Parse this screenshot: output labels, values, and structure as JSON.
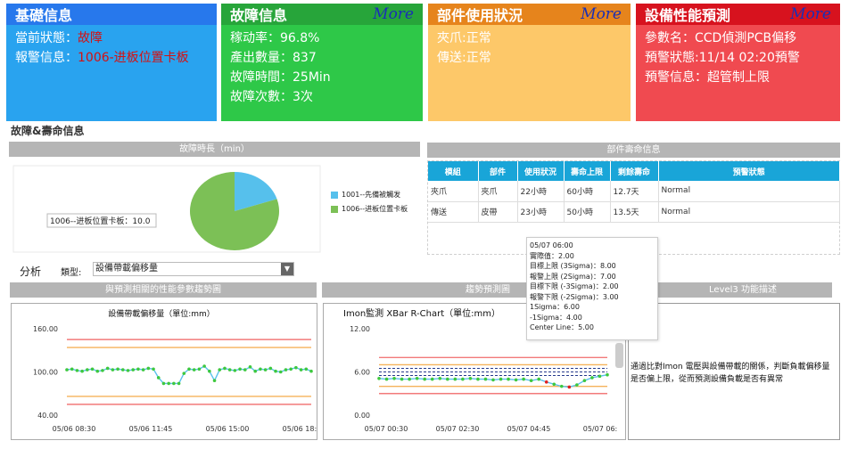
{
  "cards": {
    "basic": {
      "title": "基礎信息",
      "status_label": "當前狀態：",
      "status_value": "故障",
      "alarm_label": "報警信息：",
      "alarm_value": "1006-进板位置卡板"
    },
    "fault": {
      "title": "故障信息",
      "more": "More",
      "lines": [
        "稼动率：96.8%",
        "產出數量：837",
        "故障時間：25Min",
        "故障次數：3次"
      ]
    },
    "parts": {
      "title": "部件使用狀況",
      "more": "More",
      "lines": [
        "夾爪:正常",
        "傳送:正常"
      ]
    },
    "predict": {
      "title": "設備性能預測",
      "more": "More",
      "lines": [
        "參數名：CCD偵測PCB偏移",
        "預警狀態:11/14 02:20預警",
        "預警信息：超管制上限"
      ]
    }
  },
  "section_title": "故障&壽命信息",
  "fault_duration": {
    "bar_title": "故障時長（min）",
    "pie_label": "1006--进板位置卡板：10.0",
    "legend": [
      {
        "label": "1001--先備被觸发",
        "color": "#56c0ec"
      },
      {
        "label": "1006--进板位置卡板",
        "color": "#7cc056"
      }
    ],
    "slices": [
      {
        "name": "1001--先備被觸发",
        "value": 2.5,
        "color": "#56c0ec"
      },
      {
        "name": "1006--进板位置卡板",
        "value": 10.0,
        "color": "#7cc056"
      }
    ]
  },
  "parts_life": {
    "bar_title": "部件壽命信息",
    "headers": [
      "模組",
      "部件",
      "使用狀況",
      "壽命上限",
      "剩餘壽命",
      "預警狀態"
    ],
    "rows": [
      [
        "夾爪",
        "夾爪",
        "22小時",
        "60小時",
        "12.7天",
        "Normal"
      ],
      [
        "傳送",
        "皮帶",
        "23小時",
        "50小時",
        "13.5天",
        "Normal"
      ]
    ]
  },
  "analysis": {
    "label": "分析",
    "type_label": "類型:",
    "type_value": "設備帶載偏移量"
  },
  "bars": {
    "trend_left": "與預測相關的性能參數趨勢圖",
    "trend_mid": "趨勢預測圖",
    "level3": "Level3 功能描述"
  },
  "tooltip": {
    "lines": [
      "05/07 06:00",
      "實際值：2.00",
      "目標上限 (3Sigma)：8.00",
      "報警上限 (2Sigma)：7.00",
      "目標下限 (-3Sigma)：2.00",
      "報警下限 (-2Sigma)：3.00",
      "1Sigma：6.00",
      "-1Sigma：4.00",
      "Center Line：5.00"
    ]
  },
  "level3_text": "通過比對Imon 電壓與設備帶載的關係，判斷負載偏移量是否偏上限，從而預測設備負載是否有異常",
  "chart_data": [
    {
      "type": "line",
      "title": "設備帶載偏移量（單位:mm）",
      "ylim": [
        40,
        160
      ],
      "yticks": [
        "160.00",
        "100.00",
        "40.00"
      ],
      "xticks": [
        "05/06 08:30",
        "05/06 11:45",
        "05/06 15:00",
        "05/06 18:15"
      ],
      "limits": [
        {
          "value": 145,
          "color": "#f27a7a"
        },
        {
          "value": 134,
          "color": "#f5b25a"
        },
        {
          "value": 66,
          "color": "#f5b25a"
        },
        {
          "value": 55,
          "color": "#f27a7a"
        }
      ],
      "series": [
        {
          "values": [
            103,
            104,
            102,
            101,
            103,
            104,
            101,
            102,
            105,
            103,
            104,
            103,
            102,
            103,
            104,
            103,
            105,
            104,
            92,
            84,
            84,
            84,
            84,
            98,
            104,
            103,
            104,
            108,
            101,
            88,
            103,
            105,
            103,
            102,
            104,
            103,
            107,
            101,
            104,
            103,
            105,
            101,
            100,
            103,
            104,
            106,
            103,
            104,
            101
          ]
        }
      ]
    },
    {
      "type": "line",
      "title": "Imon監測 XBar R-Chart（單位:mm）",
      "ylim": [
        0,
        12
      ],
      "yticks": [
        "12.00",
        "6.00",
        "0.00"
      ],
      "xticks": [
        "05/07 00:30",
        "05/07 02:30",
        "05/07 04:45",
        "05/07 06:"
      ],
      "limits": [
        {
          "value": 8,
          "color": "#f27a7a"
        },
        {
          "value": 7,
          "color": "#f5b25a"
        },
        {
          "value": 6.5,
          "color": "#263a8c"
        },
        {
          "value": 6,
          "color": "#263a8c"
        },
        {
          "value": 5.5,
          "color": "#263a8c"
        },
        {
          "value": 4,
          "color": "#f5b25a"
        },
        {
          "value": 3,
          "color": "#f27a7a"
        }
      ],
      "series": [
        {
          "values": [
            5.1,
            5.0,
            5.1,
            5.0,
            5.0,
            5.1,
            5.0,
            5.0,
            5.1,
            5.0,
            5.0,
            5.0,
            5.1,
            5.0,
            5.0,
            4.9,
            5.0,
            5.0,
            4.9,
            5.0,
            4.8,
            5.0,
            4.6,
            4.3,
            4.0,
            3.9,
            4.2,
            4.8,
            5.2,
            5.4,
            5.6
          ]
        }
      ]
    }
  ]
}
